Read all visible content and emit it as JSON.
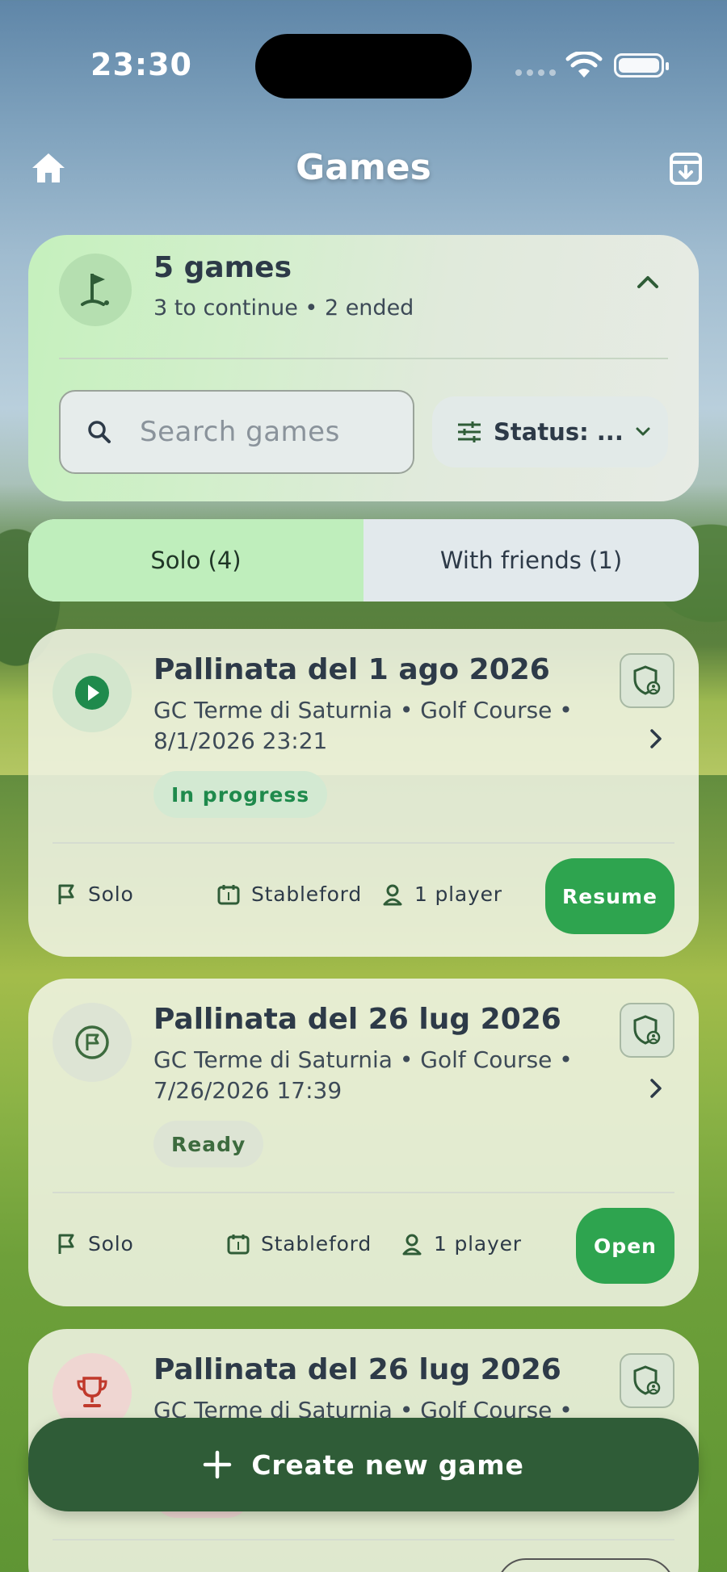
{
  "status_bar": {
    "time": "23:30"
  },
  "header": {
    "title": "Games",
    "home_icon": "home-icon",
    "archive_icon": "archive-download-icon"
  },
  "summary": {
    "count": "5 games",
    "detail": "3 to continue • 2 ended",
    "search_placeholder": "Search games",
    "status_filter": "Status: ..."
  },
  "tabs": [
    {
      "label": "Solo (4)",
      "active": true
    },
    {
      "label": "With friends (1)",
      "active": false
    }
  ],
  "games": [
    {
      "title": "Pallinata del 1 ago 2026",
      "subtitle_line1": "GC Terme di Saturnia • Golf Course •",
      "subtitle_line2": "8/1/2026 23:21",
      "status": "In progress",
      "mode": "Solo",
      "format": "Stableford",
      "players": "1 player",
      "action": "Resume",
      "icon": "play-icon",
      "icon_color": "#1f8a4c"
    },
    {
      "title": "Pallinata del 26 lug 2026",
      "subtitle_line1": "GC Terme di Saturnia • Golf Course •",
      "subtitle_line2": "7/26/2026 17:39",
      "status": "Ready",
      "mode": "Solo",
      "format": "Stableford",
      "players": "1 player",
      "action": "Open",
      "icon": "flag-circle-icon",
      "icon_color": "#3d6b3e"
    },
    {
      "title": "Pallinata del 26 lug 2026",
      "subtitle_line1": "GC Terme di Saturnia • Golf Course •",
      "icon": "trophy-icon",
      "icon_color": "#c0392b"
    }
  ],
  "create_button": {
    "label": "Create new game"
  },
  "colors": {
    "primary": "#2ea44f",
    "dark_green": "#2f5c37",
    "accent_light": "#bfeebc"
  }
}
